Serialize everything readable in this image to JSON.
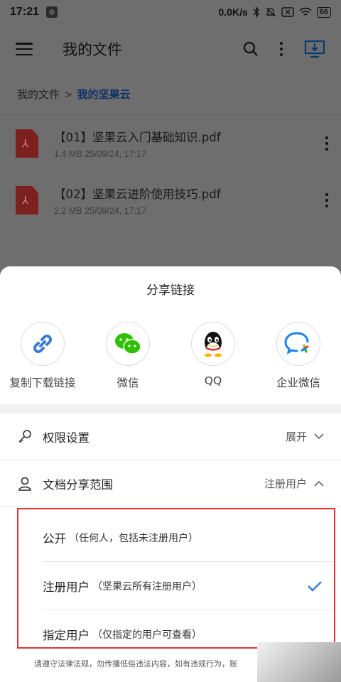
{
  "status_bar": {
    "time": "17:21",
    "speed": "0.0K/s",
    "battery": "66",
    "icons": [
      "app-badge-icon",
      "bluetooth-icon",
      "mute-icon",
      "sim-off-icon",
      "wifi-icon",
      "battery-icon"
    ]
  },
  "header": {
    "title": "我的文件",
    "icons": [
      "menu-icon",
      "search-icon",
      "more-icon",
      "desktop-download-icon"
    ]
  },
  "breadcrumb": {
    "root": "我的文件",
    "separator": ">",
    "current": "我的坚果云"
  },
  "files": [
    {
      "name": "【01】坚果云入门基础知识.pdf",
      "meta": "1.4 MB 25/09/24, 17:17",
      "icon": "pdf-icon"
    },
    {
      "name": "【02】坚果云进阶使用技巧.pdf",
      "meta": "2.2 MB 25/09/24, 17:17",
      "icon": "pdf-icon"
    }
  ],
  "sheet": {
    "title": "分享链接",
    "share_targets": [
      {
        "label": "复制下载链接",
        "icon": "link-icon"
      },
      {
        "label": "微信",
        "icon": "wechat-icon"
      },
      {
        "label": "QQ",
        "icon": "qq-icon"
      },
      {
        "label": "企业微信",
        "icon": "wecom-icon"
      }
    ],
    "permission": {
      "label": "权限设置",
      "value": "展开"
    },
    "scope": {
      "label": "文档分享范围",
      "value": "注册用户"
    },
    "options": [
      {
        "main": "公开",
        "sub": "（任何人，包括未注册用户）",
        "selected": false
      },
      {
        "main": "注册用户",
        "sub": "（坚果云所有注册用户）",
        "selected": true
      },
      {
        "main": "指定用户",
        "sub": "（仅指定的用户可查看）",
        "selected": false
      }
    ],
    "footer_note": "请遵守法律法规，勿传播低俗违法内容，如有违规行为，账"
  },
  "colors": {
    "accent": "#3a7bd5",
    "highlight_border": "#e53238",
    "breadcrumb_current": "#0e2f66"
  }
}
